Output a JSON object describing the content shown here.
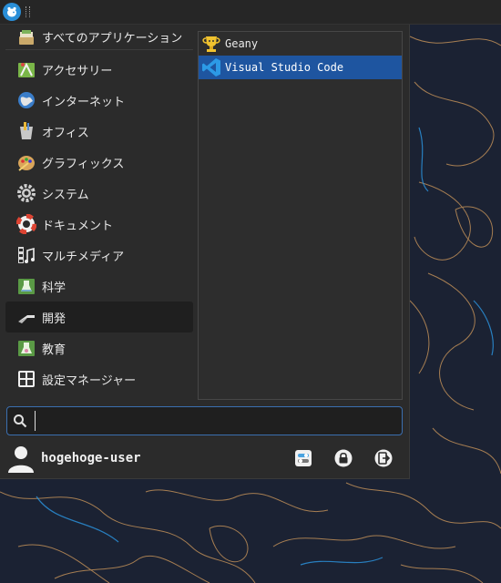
{
  "panel": {
    "menu_button_icon": "xfce-mouse-icon"
  },
  "menu": {
    "categories": [
      {
        "label": "すべてのアプリケーション",
        "icon": "all-apps-icon"
      },
      {
        "label": "アクセサリー",
        "icon": "accessories-icon"
      },
      {
        "label": "インターネット",
        "icon": "internet-globe-icon"
      },
      {
        "label": "オフィス",
        "icon": "office-icon"
      },
      {
        "label": "グラフィックス",
        "icon": "graphics-palette-icon"
      },
      {
        "label": "システム",
        "icon": "system-gear-icon"
      },
      {
        "label": "ドキュメント",
        "icon": "help-lifebuoy-icon"
      },
      {
        "label": "マルチメディア",
        "icon": "multimedia-icon"
      },
      {
        "label": "科学",
        "icon": "science-icon"
      },
      {
        "label": "開発",
        "icon": "development-icon"
      },
      {
        "label": "教育",
        "icon": "education-icon"
      },
      {
        "label": "設定マネージャー",
        "icon": "settings-manager-icon"
      }
    ],
    "active_category": "開発",
    "apps": [
      {
        "label": "Geany",
        "icon": "geany-icon"
      },
      {
        "label": "Visual Studio Code",
        "icon": "vscode-icon"
      }
    ],
    "selected_app": "Visual Studio Code",
    "search": {
      "value": "",
      "placeholder": ""
    },
    "user": {
      "name": "hogehoge-user"
    },
    "actions": [
      {
        "name": "settings-toggle",
        "icon": "settings-toggle-icon"
      },
      {
        "name": "lock-screen",
        "icon": "lock-icon"
      },
      {
        "name": "log-out",
        "icon": "logout-icon"
      }
    ]
  },
  "colors": {
    "selection": "#1e55a0",
    "search_border": "#3b6fb0",
    "wallpaper": "#1b2233",
    "contour_orange": "#c9955a",
    "contour_blue": "#2a8fd8"
  }
}
